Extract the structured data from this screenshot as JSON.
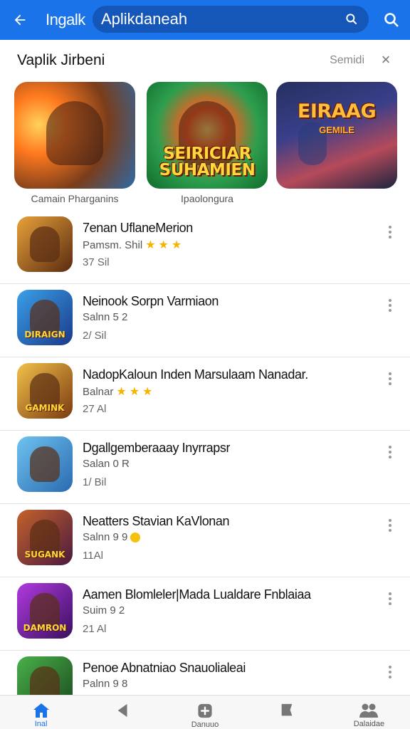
{
  "topbar": {
    "title": "Ingalk",
    "search_value": "Aplikdaneah"
  },
  "section": {
    "title": "Vaplik Jirbeni",
    "more_label": "Semidi",
    "close_glyph": "×"
  },
  "featured": [
    {
      "banner": "",
      "caption": "Camain Pharganins",
      "colors": [
        "#ff7a1f",
        "#2d6aa8"
      ]
    },
    {
      "banner": "SEIRICIAR SUHAMIEN",
      "caption": "Ipaolongura",
      "colors": [
        "#ff5a1e",
        "#2e9e4e"
      ]
    },
    {
      "banner": "EIRAAG",
      "sub": "GEMILE",
      "caption": "",
      "colors": [
        "#3a3f8a",
        "#b54a5a"
      ]
    }
  ],
  "apps": [
    {
      "name": "7enan UflaneMerion",
      "sub": "Pamsm. Shil",
      "rating": "stars",
      "size": "37 Sil",
      "icon_label": "",
      "icon_bg": "linear-gradient(135deg,#e8a23a,#5a2a10)"
    },
    {
      "name": "Neinook Sorpn Varmiaon",
      "sub": "Salnn 5 2",
      "rating": "",
      "size": "2/ Sil",
      "icon_label": "DIRAIGN",
      "icon_bg": "linear-gradient(135deg,#3aa0e8,#1a3a8a)"
    },
    {
      "name": "NadopKaloun Inden Marsulaam Nanadar.",
      "sub": "Balnar",
      "rating": "stars",
      "size": "27 Al",
      "icon_label": "GAMINK",
      "icon_bg": "linear-gradient(135deg,#f2c14a,#7a3a10)"
    },
    {
      "name": "Dgallgemberaaay Inyrrapsr",
      "sub": "Salan 0 R",
      "rating": "",
      "size": "1/ Bil",
      "icon_label": "",
      "icon_bg": "linear-gradient(135deg,#6fc3f0,#2a6ab0)"
    },
    {
      "name": "Neatters Stavian KaVlonan",
      "sub": "Salnn 9 9",
      "rating": "coin",
      "size": "11Al",
      "icon_label": "SUGANK",
      "icon_bg": "linear-gradient(135deg,#c4622a,#4a1a40)"
    },
    {
      "name": "Aamen Blomleler|Mada Lualdare Fnblaiaa",
      "sub": "Suim 9 2",
      "rating": "",
      "size": "21 Al",
      "icon_label": "DAMRON",
      "icon_bg": "linear-gradient(135deg,#b03ae0,#3a1060)"
    },
    {
      "name": "Penoe Abnatniao Snauolialeai",
      "sub": "Palnn 9 8",
      "rating": "",
      "size": "",
      "icon_label": "",
      "icon_bg": "linear-gradient(135deg,#4ab04a,#1a4a20)"
    }
  ],
  "bottom_nav": [
    {
      "label": "Inal",
      "icon": "home-icon",
      "active": true
    },
    {
      "label": "",
      "icon": "back-triangle-icon",
      "active": false
    },
    {
      "label": "Danuuo",
      "icon": "add-box-icon",
      "active": false
    },
    {
      "label": "",
      "icon": "flag-icon",
      "active": false
    },
    {
      "label": "Dalaidae",
      "icon": "people-icon",
      "active": false
    }
  ],
  "colors": {
    "primary": "#1a73e8",
    "primary_dark": "#1457b8",
    "star": "#f4b400"
  }
}
